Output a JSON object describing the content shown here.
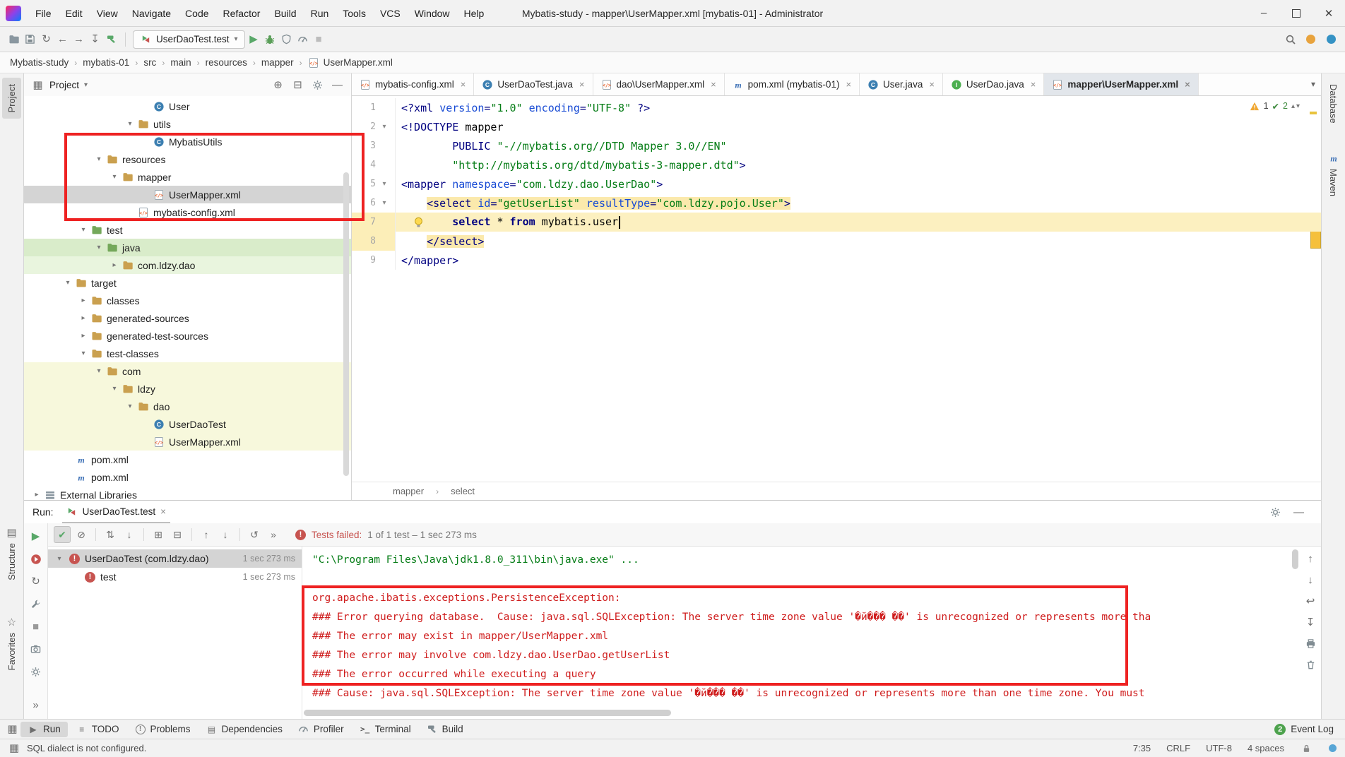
{
  "colors": {
    "error_red": "#cf1d1d",
    "annotation_red": "#ee2222",
    "string_green": "#067d17",
    "tag_navy": "#000080",
    "attr_blue": "#174ad4",
    "highlight_beige": "#fbe9ac",
    "test_source_green": "#d9ecca",
    "selection_gray": "#d4d4d4"
  },
  "window": {
    "title": "Mybatis-study - mapper\\UserMapper.xml [mybatis-01] - Administrator",
    "menu": [
      "File",
      "Edit",
      "View",
      "Navigate",
      "Code",
      "Refactor",
      "Build",
      "Run",
      "Tools",
      "VCS",
      "Window",
      "Help"
    ]
  },
  "toolbar": {
    "left_icons": [
      "open-project",
      "save-all",
      "synchronize",
      "back",
      "forward",
      "update-project",
      "build-project"
    ],
    "run_config": "UserDaoTest.test",
    "run_icons": [
      "run",
      "debug",
      "coverage",
      "profiler",
      "stop"
    ],
    "right_icons": [
      "search-everywhere",
      "updates",
      "info"
    ]
  },
  "breadcrumbs": [
    "Mybatis-study",
    "mybatis-01",
    "src",
    "main",
    "resources",
    "mapper",
    "UserMapper.xml"
  ],
  "left_stripe": {
    "top": [
      "Project"
    ],
    "bottom": [
      "Structure",
      "Favorites"
    ]
  },
  "right_stripe": [
    "Database",
    "Maven"
  ],
  "project_panel": {
    "title": "Project",
    "header_icons": [
      "locate-file",
      "collapse-all",
      "settings",
      "hide"
    ],
    "tree": [
      {
        "label": "User",
        "icon": "class",
        "indent": 8
      },
      {
        "label": "utils",
        "icon": "folder",
        "indent": 7,
        "chevron": "down"
      },
      {
        "label": "MybatisUtils",
        "icon": "class",
        "indent": 8
      },
      {
        "label": "resources",
        "icon": "folder",
        "indent": 5,
        "chevron": "down"
      },
      {
        "label": "mapper",
        "icon": "folder",
        "indent": 6,
        "chevron": "down"
      },
      {
        "label": "UserMapper.xml",
        "icon": "xml",
        "indent": 8,
        "selected": true
      },
      {
        "label": "mybatis-config.xml",
        "icon": "xml",
        "indent": 7
      },
      {
        "label": "test",
        "icon": "folder-green",
        "indent": 4,
        "chevron": "down"
      },
      {
        "label": "java",
        "icon": "folder-green",
        "indent": 5,
        "chevron": "down",
        "bg": "green"
      },
      {
        "label": "com.ldzy.dao",
        "icon": "package",
        "indent": 6,
        "chevron": "right",
        "bg": "green-light"
      },
      {
        "label": "target",
        "icon": "folder",
        "indent": 3,
        "chevron": "down"
      },
      {
        "label": "classes",
        "icon": "folder",
        "indent": 4,
        "chevron": "right"
      },
      {
        "label": "generated-sources",
        "icon": "folder",
        "indent": 4,
        "chevron": "right"
      },
      {
        "label": "generated-test-sources",
        "icon": "folder",
        "indent": 4,
        "chevron": "right"
      },
      {
        "label": "test-classes",
        "icon": "folder",
        "indent": 4,
        "chevron": "down"
      },
      {
        "label": "com",
        "icon": "folder",
        "indent": 5,
        "chevron": "down",
        "bg": "yellow"
      },
      {
        "label": "ldzy",
        "icon": "folder",
        "indent": 6,
        "chevron": "down",
        "bg": "yellow"
      },
      {
        "label": "dao",
        "icon": "folder",
        "indent": 7,
        "chevron": "down",
        "bg": "yellow"
      },
      {
        "label": "UserDaoTest",
        "icon": "test-class",
        "indent": 8,
        "bg": "yellow"
      },
      {
        "label": "UserMapper.xml",
        "icon": "xml",
        "indent": 8,
        "bg": "yellow"
      },
      {
        "label": "pom.xml",
        "icon": "maven",
        "indent": 3
      },
      {
        "label": "pom.xml",
        "icon": "maven",
        "indent": 3
      },
      {
        "label": "External Libraries",
        "icon": "libs",
        "indent": 1,
        "chevron": "right"
      }
    ]
  },
  "editor": {
    "tabs": [
      {
        "label": "mybatis-config.xml",
        "icon": "xml"
      },
      {
        "label": "UserDaoTest.java",
        "icon": "test-class"
      },
      {
        "label": "dao\\UserMapper.xml",
        "icon": "xml"
      },
      {
        "label": "pom.xml (mybatis-01)",
        "icon": "maven"
      },
      {
        "label": "User.java",
        "icon": "class"
      },
      {
        "label": "UserDao.java",
        "icon": "interface"
      },
      {
        "label": "mapper\\UserMapper.xml",
        "icon": "xml",
        "active": true
      }
    ],
    "inspections": {
      "warnings": "1",
      "ok": "2"
    },
    "lines": [
      {
        "num": "1",
        "segs": [
          [
            "tag",
            "<?xml "
          ],
          [
            "attr",
            "version"
          ],
          [
            "tag",
            "="
          ],
          [
            "str",
            "\"1.0\""
          ],
          [
            "pln",
            " "
          ],
          [
            "attr",
            "encoding"
          ],
          [
            "tag",
            "="
          ],
          [
            "str",
            "\"UTF-8\""
          ],
          [
            "tag",
            " ?>"
          ]
        ]
      },
      {
        "num": "2",
        "fold": true,
        "segs": [
          [
            "tag",
            "<!DOCTYPE "
          ],
          [
            "pln",
            "mapper"
          ]
        ]
      },
      {
        "num": "3",
        "segs": [
          [
            "pln",
            "        "
          ],
          [
            "tag",
            "PUBLIC "
          ],
          [
            "str",
            "\"-//mybatis.org//DTD Mapper 3.0//EN\""
          ]
        ]
      },
      {
        "num": "4",
        "segs": [
          [
            "pln",
            "        "
          ],
          [
            "str",
            "\"http://mybatis.org/dtd/mybatis-3-mapper.dtd\""
          ],
          [
            "tag",
            ">"
          ]
        ]
      },
      {
        "num": "5",
        "fold": true,
        "segs": [
          [
            "tag",
            "<mapper "
          ],
          [
            "attr",
            "namespace"
          ],
          [
            "tag",
            "="
          ],
          [
            "str",
            "\"com.ldzy.dao.UserDao\""
          ],
          [
            "tag",
            ">"
          ]
        ]
      },
      {
        "num": "6",
        "fold": true,
        "segs": [
          [
            "pln",
            "    "
          ],
          [
            "tag hl",
            "<select "
          ],
          [
            "attr hl",
            "id"
          ],
          [
            "tag hl",
            "="
          ],
          [
            "str hl",
            "\"getUserList\""
          ],
          [
            "pln hl",
            " "
          ],
          [
            "attr hl",
            "resultType"
          ],
          [
            "tag hl",
            "="
          ],
          [
            "str hl",
            "\"com.ldzy.pojo.User\""
          ],
          [
            "tag hl",
            ">"
          ]
        ]
      },
      {
        "num": "7",
        "cur": true,
        "bulb": true,
        "segs": [
          [
            "pln",
            "        "
          ],
          [
            "kw",
            "select"
          ],
          [
            "pln",
            " * "
          ],
          [
            "kw",
            "from"
          ],
          [
            "pln",
            " mybatis.user"
          ],
          [
            "caret",
            ""
          ]
        ]
      },
      {
        "num": "8",
        "gut": true,
        "segs": [
          [
            "pln",
            "    "
          ],
          [
            "tag hl",
            "</select>"
          ]
        ]
      },
      {
        "num": "9",
        "segs": [
          [
            "tag",
            "</mapper>"
          ]
        ]
      }
    ],
    "breadcrumb_bottom": [
      "mapper",
      "select"
    ]
  },
  "run_panel": {
    "label": "Run:",
    "tab": "UserDaoTest.test",
    "status_prefix": "Tests failed:",
    "status_rest": "1 of 1 test – 1 sec 273 ms",
    "toolbar_icons": [
      {
        "name": "show-passed",
        "pressed": true
      },
      {
        "name": "show-ignored"
      },
      {
        "sep": true
      },
      {
        "name": "sort-alphabetically"
      },
      {
        "name": "sort-by-duration"
      },
      {
        "sep": true
      },
      {
        "name": "expand-all"
      },
      {
        "name": "collapse-all"
      },
      {
        "sep": true
      },
      {
        "name": "previous-failed"
      },
      {
        "name": "next-failed"
      },
      {
        "sep": true
      },
      {
        "name": "test-history"
      },
      {
        "name": "more"
      }
    ],
    "left_icons": [
      "rerun",
      "rerun-failed",
      "toggle-auto-test",
      "adjust-settings",
      "pause-output",
      "thread-dump",
      "restore-layout"
    ],
    "console_icons": [
      "scroll-up",
      "scroll-down",
      "soft-wrap",
      "scroll-to-end",
      "print",
      "clear-all"
    ],
    "tests": [
      {
        "name": "UserDaoTest (com.ldzy.dao)",
        "time": "1 sec 273 ms",
        "chevron": true,
        "selected": true,
        "indent": 0
      },
      {
        "name": "test",
        "time": "1 sec 273 ms",
        "indent": 1
      }
    ],
    "console": [
      {
        "cls": "cmd",
        "text": "\"C:\\Program Files\\Java\\jdk1.8.0_311\\bin\\java.exe\" ..."
      },
      {
        "cls": "blank",
        "text": ""
      },
      {
        "cls": "err",
        "text": "org.apache.ibatis.exceptions.PersistenceException: "
      },
      {
        "cls": "err",
        "text": "### Error querying database.  Cause: java.sql.SQLException: The server time zone value '�й��� ��' is unrecognized or represents more tha"
      },
      {
        "cls": "err",
        "text": "### The error may exist in mapper/UserMapper.xml"
      },
      {
        "cls": "err",
        "text": "### The error may involve com.ldzy.dao.UserDao.getUserList"
      },
      {
        "cls": "err",
        "text": "### The error occurred while executing a query"
      },
      {
        "cls": "err",
        "text": "### Cause: java.sql.SQLException: The server time zone value '�й��� ��' is unrecognized or represents more than one time zone. You must"
      }
    ]
  },
  "bottom_bar": {
    "left": [
      {
        "label": "Run",
        "icon": "run-small",
        "active": true
      },
      {
        "label": "TODO",
        "icon": "todo"
      },
      {
        "label": "Problems",
        "icon": "problems"
      },
      {
        "label": "Dependencies",
        "icon": "dependencies"
      },
      {
        "label": "Profiler",
        "icon": "profiler-small"
      },
      {
        "label": "Terminal",
        "icon": "terminal"
      },
      {
        "label": "Build",
        "icon": "build-small"
      }
    ],
    "right": {
      "badge": "2",
      "label": "Event Log"
    }
  },
  "status_bar": {
    "message": "SQL dialect is not configured.",
    "position": "7:35",
    "line_sep": "CRLF",
    "encoding": "UTF-8",
    "indent": "4 spaces"
  }
}
